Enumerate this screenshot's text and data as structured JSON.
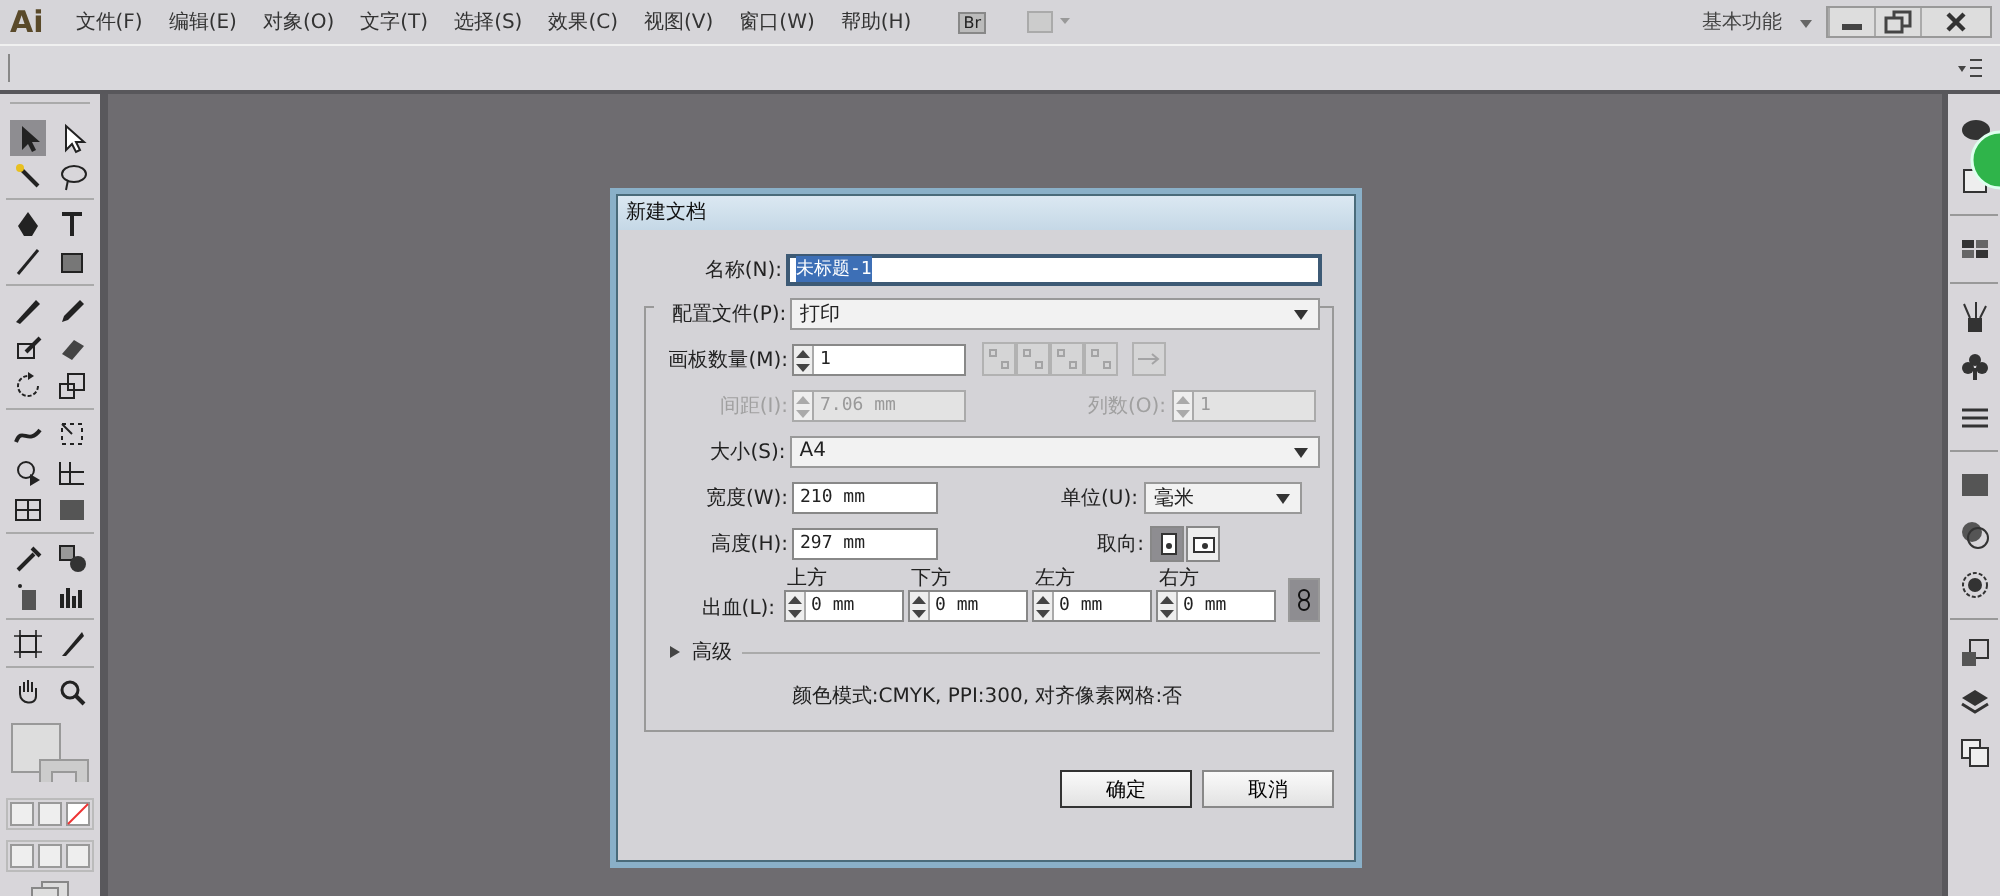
{
  "app": {
    "logo": "Ai",
    "bridge": "Br"
  },
  "menu": [
    "文件(F)",
    "编辑(E)",
    "对象(O)",
    "文字(T)",
    "选择(S)",
    "效果(C)",
    "视图(V)",
    "窗口(W)",
    "帮助(H)"
  ],
  "workspace": "基本功能",
  "toolbox": {
    "tools": [
      {
        "selected": true
      },
      {
        "selected": false
      },
      {
        "selected": false
      },
      {
        "selected": false
      },
      {
        "selected": false
      },
      {
        "selected": false
      },
      {
        "selected": false
      },
      {
        "selected": false
      },
      {
        "selected": false
      },
      {
        "selected": false
      },
      {
        "selected": false
      },
      {
        "selected": false
      },
      {
        "selected": false
      },
      {
        "selected": false
      },
      {
        "selected": false
      },
      {
        "selected": false
      },
      {
        "selected": false
      },
      {
        "selected": false
      },
      {
        "selected": false
      },
      {
        "selected": false
      },
      {
        "selected": false
      },
      {
        "selected": false
      },
      {
        "selected": false
      },
      {
        "selected": false
      },
      {
        "selected": false
      },
      {
        "selected": false
      },
      {
        "selected": false
      },
      {
        "selected": false
      }
    ]
  },
  "dialog": {
    "title": "新建文档",
    "name": {
      "label": "名称(N):",
      "value": "未标题-1",
      "selected": true
    },
    "profile": {
      "label": "配置文件(P):",
      "value": "打印"
    },
    "artboards": {
      "label": "画板数量(M):",
      "value": "1",
      "arrange_disabled": true
    },
    "spacing": {
      "label": "间距(I):",
      "value": "7.06 mm",
      "disabled": true
    },
    "columns": {
      "label": "列数(O):",
      "value": "1",
      "disabled": true
    },
    "size": {
      "label": "大小(S):",
      "value": "A4"
    },
    "width": {
      "label": "宽度(W):",
      "value": "210 mm"
    },
    "units": {
      "label": "单位(U):",
      "value": "毫米"
    },
    "height": {
      "label": "高度(H):",
      "value": "297 mm"
    },
    "orientation": {
      "label": "取向:",
      "options": [
        {
          "selected": true
        },
        {
          "selected": false
        }
      ]
    },
    "bleed": {
      "label": "出血(L):",
      "linked": true,
      "fields": [
        {
          "label": "上方",
          "value": "0 mm"
        },
        {
          "label": "下方",
          "value": "0 mm"
        },
        {
          "label": "左方",
          "value": "0 mm"
        },
        {
          "label": "右方",
          "value": "0 mm"
        }
      ]
    },
    "advanced": {
      "label": "高级",
      "expanded": false
    },
    "info": "颜色模式:CMYK, PPI:300, 对齐像素网格:否",
    "buttons": [
      "确定",
      "取消"
    ]
  }
}
